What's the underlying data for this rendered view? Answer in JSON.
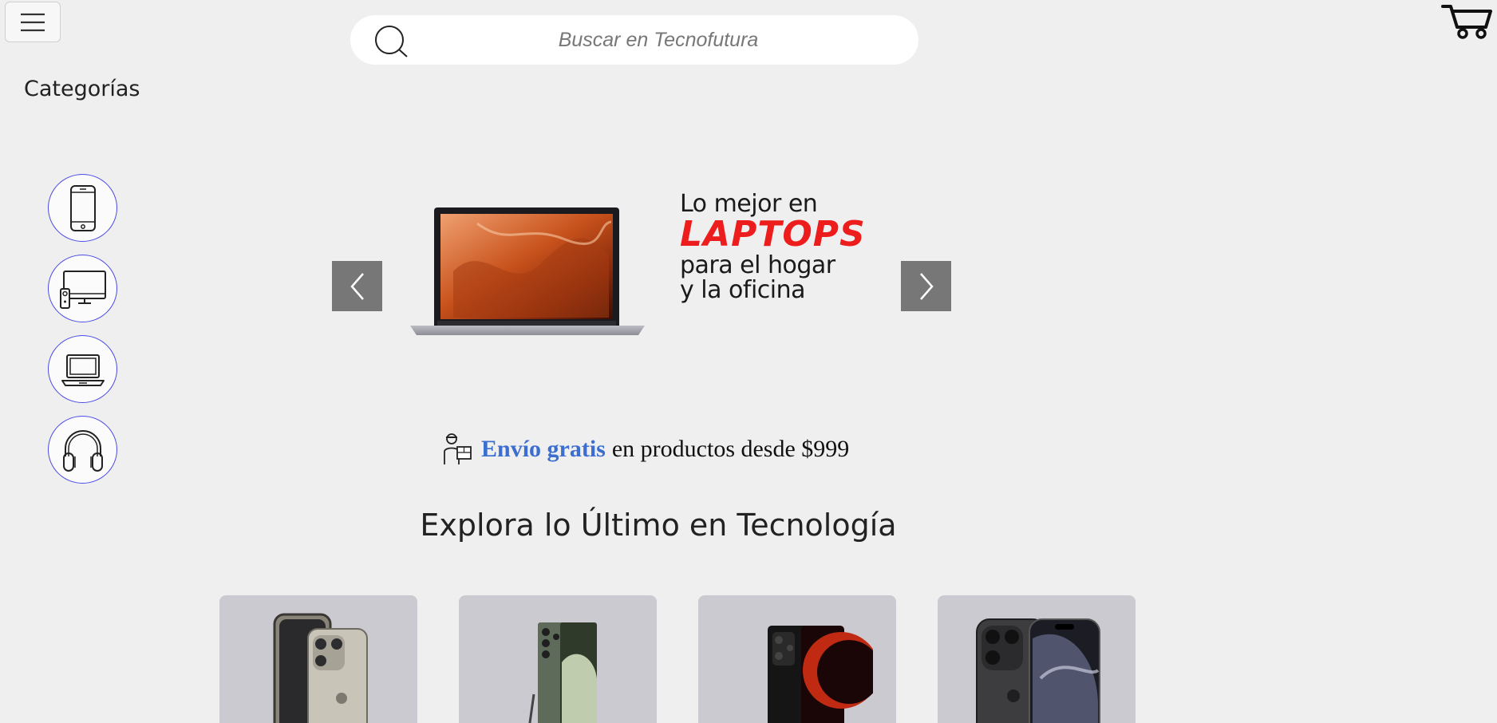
{
  "header": {
    "search_placeholder": "Buscar en Tecnofutura",
    "menu_icon": "hamburger-menu-icon",
    "search_icon": "search-icon",
    "cart_icon": "cart-icon"
  },
  "sidebar": {
    "title": "Categorías",
    "items": [
      {
        "icon": "smartphone-icon"
      },
      {
        "icon": "tv-icon"
      },
      {
        "icon": "laptop-icon"
      },
      {
        "icon": "headphones-icon"
      }
    ],
    "accent_color": "#4a4ae8"
  },
  "carousel": {
    "prev_icon": "chevron-left-icon",
    "next_icon": "chevron-right-icon",
    "banner": {
      "line1": "Lo mejor en",
      "highlight": "LAPTOPS",
      "line2": "para el hogar",
      "line3": "y la oficina",
      "highlight_color": "#ee1d1d"
    }
  },
  "shipping": {
    "icon": "delivery-person-icon",
    "highlight": "Envío gratis",
    "text": "en productos desde $999",
    "highlight_color": "#3b6ecf"
  },
  "products_section": {
    "title": "Explora lo Último en Tecnología",
    "products": [
      {
        "image": "iphone-15-pro-natural"
      },
      {
        "image": "galaxy-s23-ultra-green"
      },
      {
        "image": "xiaomi-13t-black"
      },
      {
        "image": "iphone-16-pro-black"
      }
    ]
  }
}
